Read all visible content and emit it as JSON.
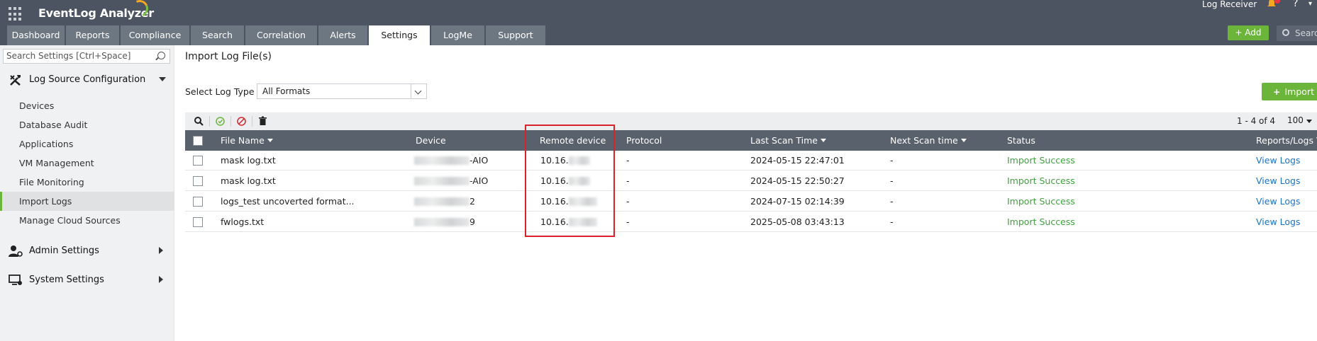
{
  "app": {
    "title": "EventLog Analyzer",
    "log_receiver": "Log Receiver",
    "help": "?"
  },
  "tabs": [
    {
      "label": "Dashboard"
    },
    {
      "label": "Reports"
    },
    {
      "label": "Compliance"
    },
    {
      "label": "Search"
    },
    {
      "label": "Correlation"
    },
    {
      "label": "Alerts"
    },
    {
      "label": "Settings"
    },
    {
      "label": "LogMe"
    },
    {
      "label": "Support"
    }
  ],
  "header_actions": {
    "add_label": "+ Add",
    "search_placeholder": "Search"
  },
  "sidebar": {
    "search_placeholder": "Search Settings [Ctrl+Space]",
    "sections": [
      {
        "label": "Log Source Configuration",
        "icon": "tools-icon"
      },
      {
        "label": "Admin Settings",
        "icon": "admin-user-icon"
      },
      {
        "label": "System Settings",
        "icon": "monitor-gear-icon"
      }
    ],
    "items": [
      {
        "label": "Devices"
      },
      {
        "label": "Database Audit"
      },
      {
        "label": "Applications"
      },
      {
        "label": "VM Management"
      },
      {
        "label": "File Monitoring"
      },
      {
        "label": "Import Logs"
      },
      {
        "label": "Manage Cloud Sources"
      }
    ]
  },
  "main": {
    "title": "Import Log File(s)",
    "select_label": "Select Log Type",
    "select_value": "All Formats",
    "import_label": "Import",
    "pager": "1 - 4 of 4",
    "page_size": "100",
    "columns": {
      "file_name": "File Name",
      "device": "Device",
      "remote_device": "Remote device",
      "protocol": "Protocol",
      "last_scan": "Last Scan Time",
      "next_scan": "Next Scan time",
      "status": "Status",
      "reports": "Reports/Logs Vi"
    },
    "rows": [
      {
        "file": "mask log.txt",
        "device": "-AIO",
        "remote": "10.16.",
        "protocol": "-",
        "last_scan": "2024-05-15 22:47:01",
        "next_scan": "-",
        "status": "Import Success",
        "action": "View Logs"
      },
      {
        "file": "mask log.txt",
        "device": "-AIO",
        "remote": "10.16.",
        "protocol": "-",
        "last_scan": "2024-05-15 22:50:27",
        "next_scan": "-",
        "status": "Import Success",
        "action": "View Logs"
      },
      {
        "file": "logs_test uncoverted format...",
        "device": "2",
        "remote": "10.16.",
        "protocol": "-",
        "last_scan": "2024-07-15 02:14:39",
        "next_scan": "-",
        "status": "Import Success",
        "action": "View Logs"
      },
      {
        "file": "fwlogs.txt",
        "device": "9",
        "remote": "10.16.",
        "protocol": "-",
        "last_scan": "2025-05-08 03:43:13",
        "next_scan": "-",
        "status": "Import Success",
        "action": "View Logs"
      }
    ]
  },
  "colors": {
    "topbar": "#4b5460",
    "tab": "#6d7782",
    "accent_green": "#6bb53a",
    "success": "#3fa33d",
    "link": "#1d73c4",
    "highlight": "#d9222a"
  }
}
